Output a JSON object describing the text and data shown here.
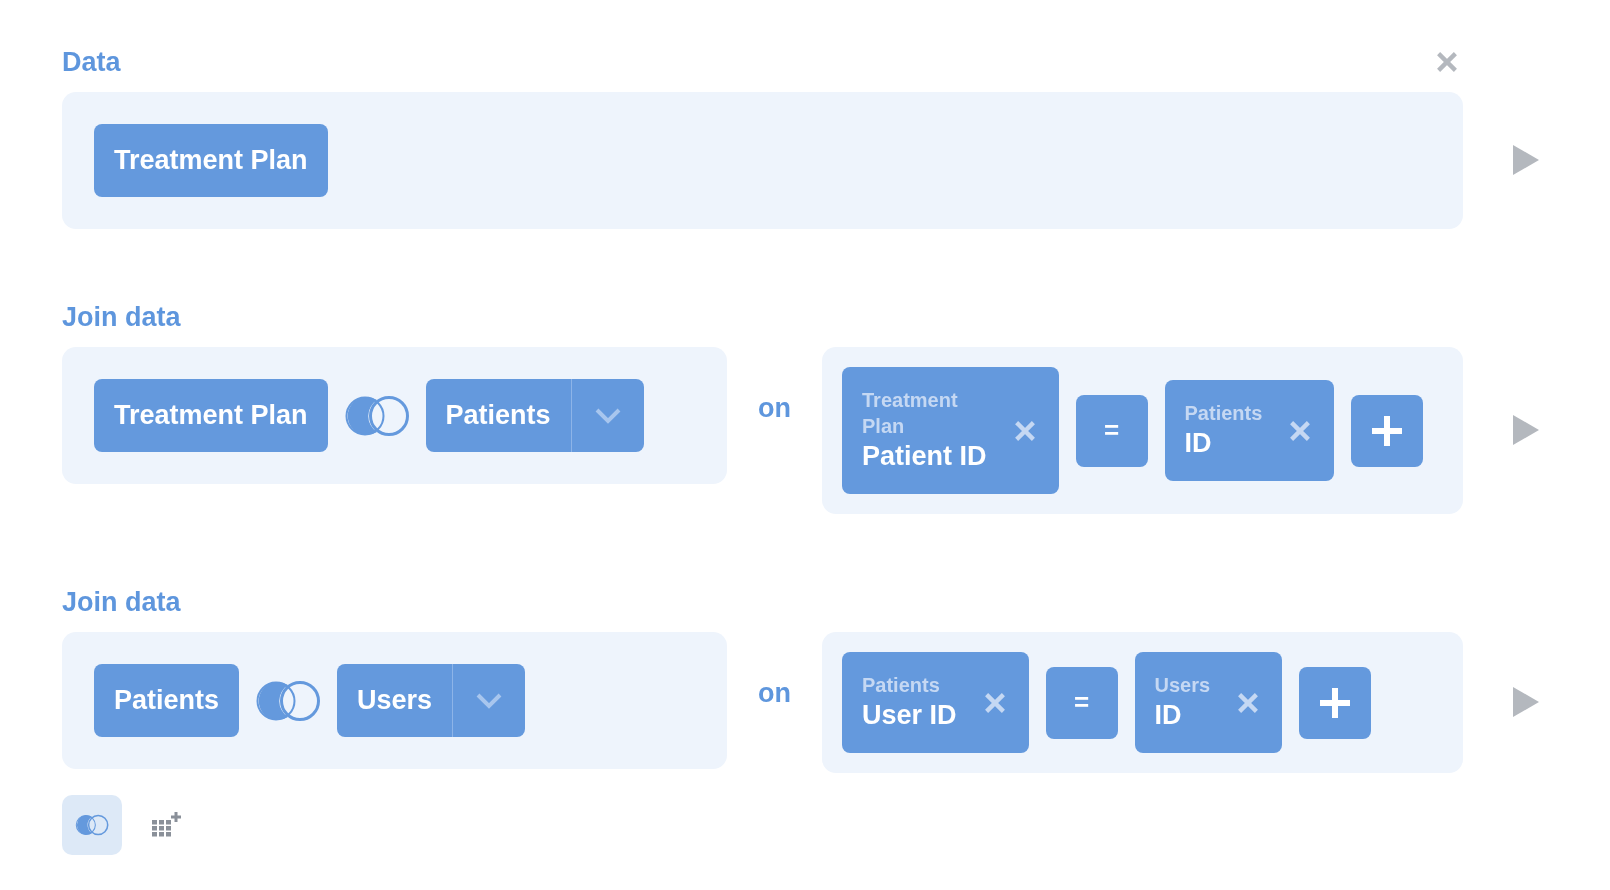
{
  "sections": [
    {
      "kind": "data",
      "title": "Data",
      "table": "Treatment Plan"
    },
    {
      "kind": "join",
      "title": "Join data",
      "left_table": "Treatment Plan",
      "right_table": "Patients",
      "on_label": "on",
      "conditions": [
        {
          "left_table": "Treatment Plan",
          "left_field": "Patient ID",
          "operator": "=",
          "right_table": "Patients",
          "right_field": "ID"
        }
      ]
    },
    {
      "kind": "join",
      "title": "Join data",
      "left_table": "Patients",
      "right_table": "Users",
      "on_label": "on",
      "conditions": [
        {
          "left_table": "Patients",
          "left_field": "User ID",
          "operator": "=",
          "right_table": "Users",
          "right_field": "ID"
        }
      ]
    }
  ]
}
